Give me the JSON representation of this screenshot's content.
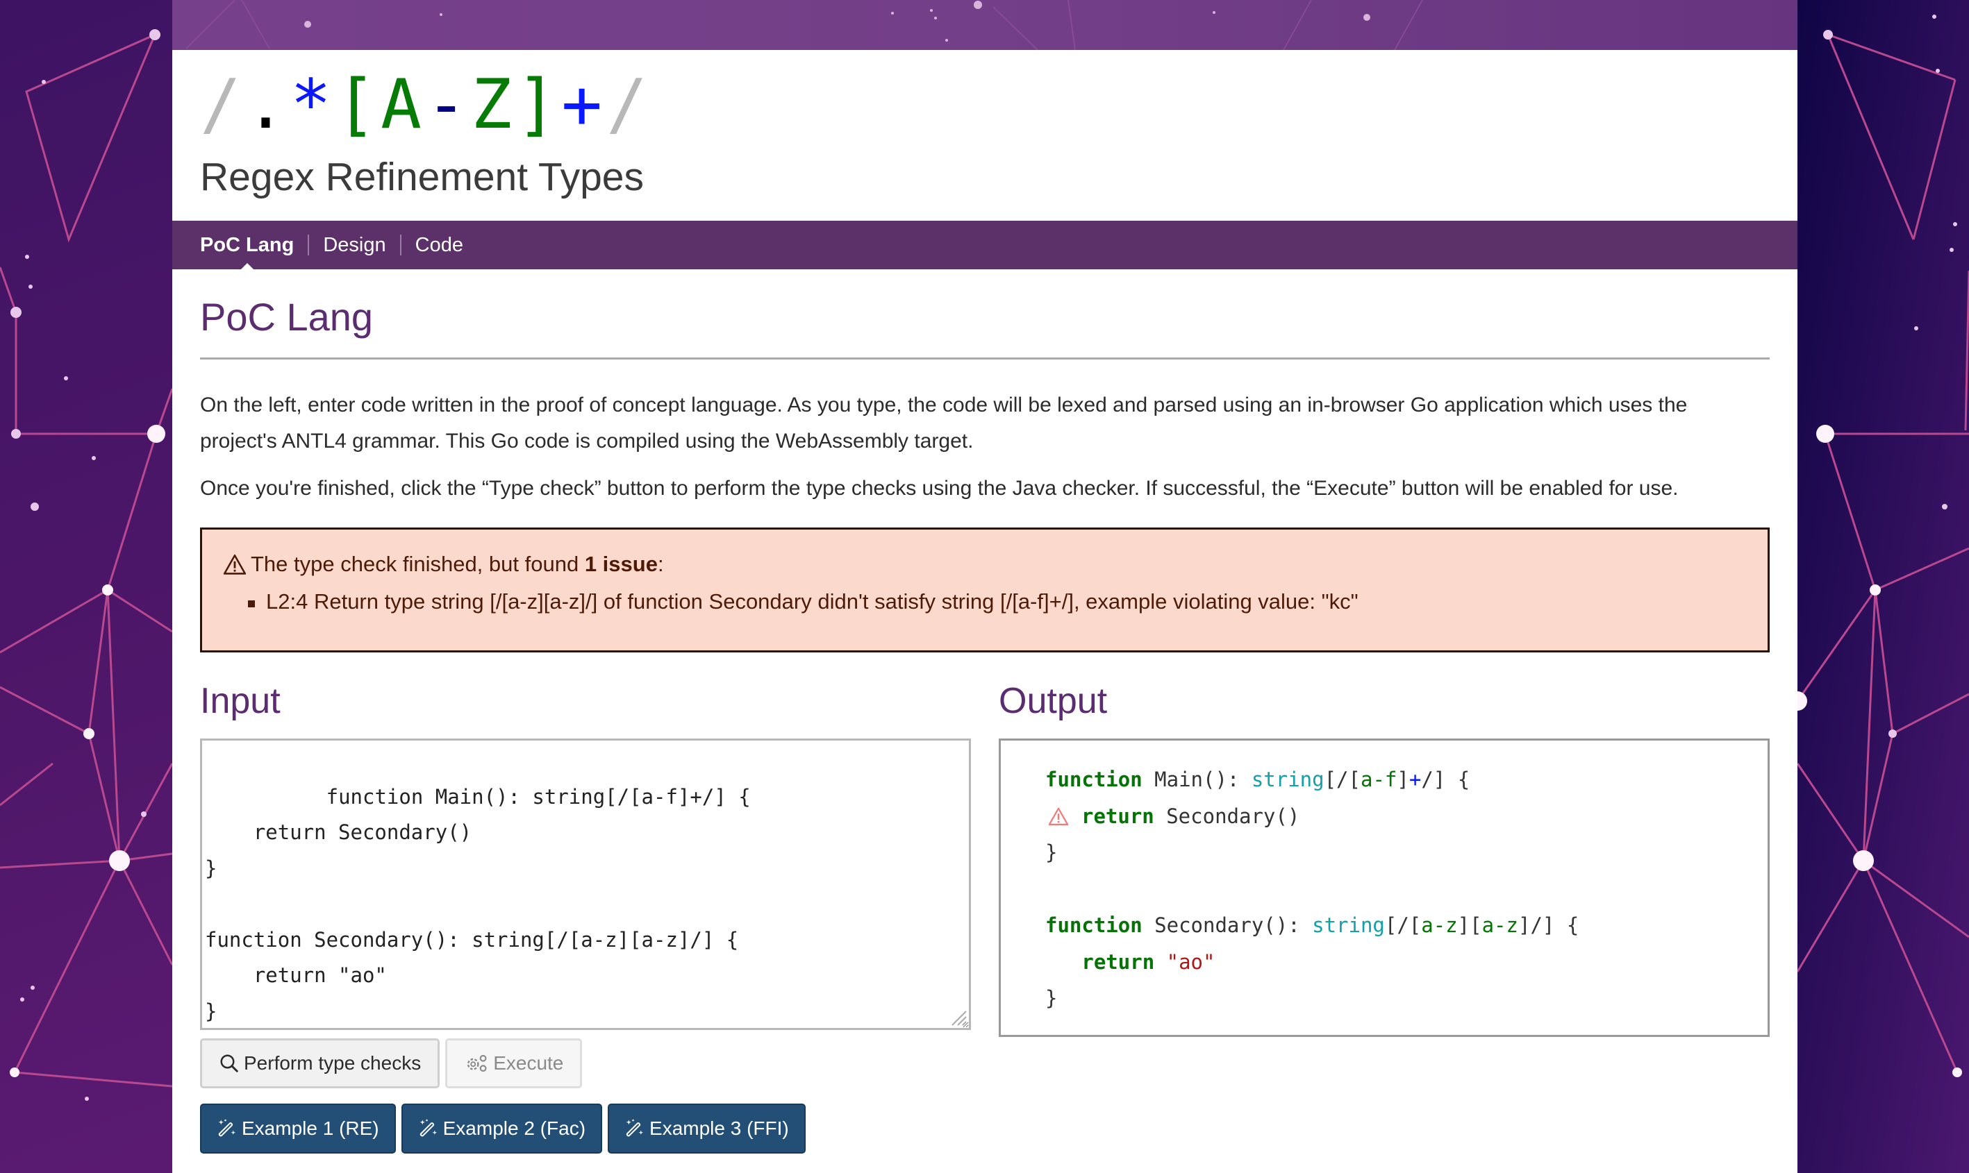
{
  "logo": {
    "parts": [
      {
        "text": "/",
        "role": "slash"
      },
      {
        "text": ".",
        "role": "dot"
      },
      {
        "text": "*",
        "role": "op"
      },
      {
        "text": "[A",
        "role": "cls"
      },
      {
        "text": "-",
        "role": "dash"
      },
      {
        "text": "Z]",
        "role": "cls"
      },
      {
        "text": "+",
        "role": "op"
      },
      {
        "text": "/",
        "role": "slash"
      }
    ]
  },
  "site_title": "Regex Refinement Types",
  "nav": {
    "items": [
      {
        "label": "PoC Lang",
        "active": true
      },
      {
        "label": "Design",
        "active": false
      },
      {
        "label": "Code",
        "active": false
      }
    ]
  },
  "page": {
    "title": "PoC Lang",
    "paragraphs": [
      "On the left, enter code written in the proof of concept language. As you type, the code will be lexed and parsed using an in-browser Go application which uses the project's ANTL4 grammar. This Go code is compiled using the WebAssembly target.",
      "Once you're finished, click the “Type check” button to perform the type checks using the Java checker. If successful, the “Execute” button will be enabled for use."
    ]
  },
  "alert": {
    "icon": "warning-triangle-icon",
    "prefix": "The type check finished, but found ",
    "count_label": "1 issue",
    "suffix": ":",
    "issues": [
      "L2:4 Return type string [/[a-z][a-z]/] of function Secondary didn't satisfy string [/[a-f]+/], example violating value: \"kc\""
    ]
  },
  "input": {
    "title": "Input",
    "code": "function Main(): string[/[a-f]+/] {\n    return Secondary()\n}\n\nfunction Secondary(): string[/[a-z][a-z]/] {\n    return \"ao\"\n}"
  },
  "output": {
    "title": "Output",
    "lines": {
      "l1_kw": "function",
      "l1_name": " Main(): ",
      "l1_type": "string",
      "l1_open": "[/[",
      "l1_range": "a-f",
      "l1_close": "]",
      "l1_plus": "+",
      "l1_end": "/] {",
      "l2_kw": "return",
      "l2_rest": " Secondary()",
      "l3": "}",
      "l5_kw": "function",
      "l5_name": " Secondary(): ",
      "l5_type": "string",
      "l5_open": "[/[",
      "l5_range1": "a-z",
      "l5_mid": "][",
      "l5_range2": "a-z",
      "l5_end": "]/] {",
      "l6_kw": "return",
      "l6_str": "\"ao\"",
      "l7": "}"
    },
    "warning_line": 2
  },
  "buttons": {
    "type_check": {
      "label": "Perform type checks",
      "icon": "search-icon",
      "enabled": true
    },
    "execute": {
      "label": "Execute",
      "icon": "gears-icon",
      "enabled": false
    },
    "examples": [
      {
        "label": "Example 1 (RE)",
        "icon": "magic-wand-icon"
      },
      {
        "label": "Example 2 (Fac)",
        "icon": "magic-wand-icon"
      },
      {
        "label": "Example 3 (FFI)",
        "icon": "magic-wand-icon"
      }
    ]
  },
  "colors": {
    "nav_bg": "#5c3068",
    "heading": "#5b2c6f",
    "alert_bg": "#fbdacd",
    "primary_button": "#234f76",
    "keyword": "#067306",
    "type": "#14a0a8",
    "string": "#b01818"
  }
}
